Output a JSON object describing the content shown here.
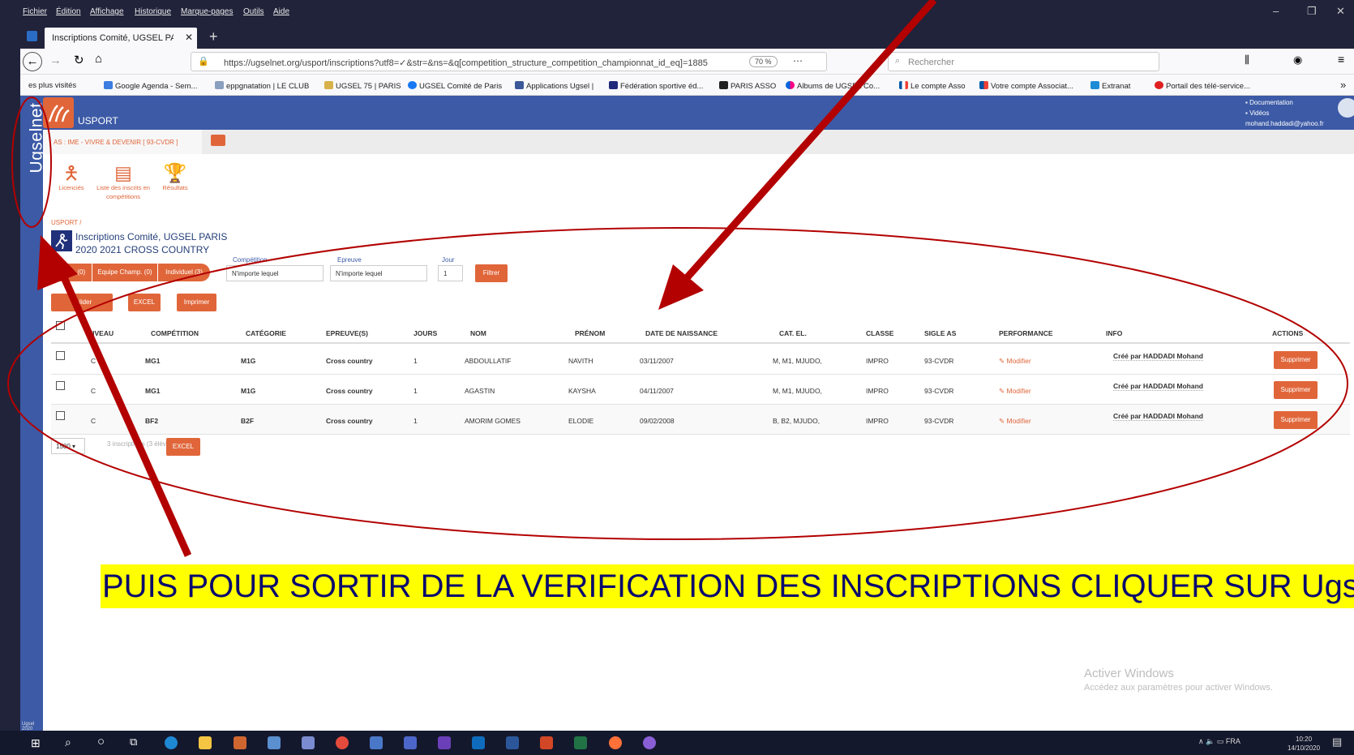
{
  "browser": {
    "menus": [
      "Fichier",
      "Édition",
      "Affichage",
      "Historique",
      "Marque-pages",
      "Outils",
      "Aide"
    ],
    "tab_title": "Inscriptions Comité, UGSEL PARIS",
    "url": "https://ugselnet.org/usport/inscriptions?utf8=✓&str=&ns=&q[competition_structure_competition_championnat_id_eq]=1885",
    "zoom": "70 %",
    "search_placeholder": "Rechercher",
    "bookmarks": [
      "es plus visités",
      "Google Agenda - Sem...",
      "eppgnatation | LE CLUB",
      "UGSEL 75 | PARIS",
      "UGSEL Comité de Paris",
      "Applications Ugsel |",
      "Fédération sportive éd...",
      "PARIS ASSO",
      "Albums de UGSEL Co...",
      "Le compte Asso",
      "Votre compte Associat...",
      "Extranat",
      "Portail des télé-service..."
    ]
  },
  "sidebar": {
    "label": "Ugselnet",
    "footer": "Ugsel 2020"
  },
  "header": {
    "brand": "USPORT",
    "links": [
      "Documentation",
      "Vidéos"
    ],
    "email": "mohand.haddadi@yahoo.fr"
  },
  "club_tab": "AS : IME - VIVRE & DEVENIR [ 93-CVDR ]",
  "app_icons": [
    {
      "label": "Licenciés",
      "icon": "person-icon"
    },
    {
      "label": "Liste des inscrits en compétitions",
      "icon": "list-icon"
    },
    {
      "label": "Résultats",
      "icon": "trophy-icon"
    }
  ],
  "breadcrumb": "USPORT /",
  "page_title": "Inscriptions Comité, UGSEL PARIS",
  "page_subtitle": "2020 2021 CROSS COUNTRY",
  "filters": {
    "segments": [
      "Relais (0)",
      "Equipe Champ. (0)",
      "Individuel (3)"
    ],
    "competition_label": "Compétition",
    "competition_value": "N'importe lequel",
    "epreuve_label": "Epreuve",
    "epreuve_value": "N'importe lequel",
    "jour_label": "Jour",
    "jour_value": "1",
    "filter_button": "Filtrer"
  },
  "actions": {
    "valider": "Valider",
    "excel": "EXCEL",
    "print": "Imprimer"
  },
  "table": {
    "headers": [
      "NIVEAU",
      "COMPÉTITION",
      "CATÉGORIE",
      "EPREUVE(S)",
      "JOURS",
      "NOM",
      "PRÉNOM",
      "DATE DE NAISSANCE",
      "CAT. EL.",
      "CLASSE",
      "SIGLE AS",
      "PERFORMANCE",
      "INFO",
      "ACTIONS"
    ],
    "rows": [
      {
        "niveau": "C",
        "competition": "MG1",
        "categorie": "M1G",
        "epreuve": "Cross country",
        "jours": "1",
        "nom": "ABDOULLATIF",
        "prenom": "NAVITH",
        "naissance": "03/11/2007",
        "cat_el": "M, M1, MJUDO,",
        "classe": "IMPRO",
        "sigle": "93-CVDR",
        "performance": "Modifier",
        "info": "Créé par HADDADI Mohand",
        "action": "Supprimer"
      },
      {
        "niveau": "C",
        "competition": "MG1",
        "categorie": "M1G",
        "epreuve": "Cross country",
        "jours": "1",
        "nom": "AGASTIN",
        "prenom": "KAYSHA",
        "naissance": "04/11/2007",
        "cat_el": "M, M1, MJUDO,",
        "classe": "IMPRO",
        "sigle": "93-CVDR",
        "performance": "Modifier",
        "info": "Créé par HADDADI Mohand",
        "action": "Supprimer"
      },
      {
        "niveau": "C",
        "competition": "BF2",
        "categorie": "B2F",
        "epreuve": "Cross country",
        "jours": "1",
        "nom": "AMORIM GOMES",
        "prenom": "ELODIE",
        "naissance": "09/02/2008",
        "cat_el": "B, B2, MJUDO,",
        "classe": "IMPRO",
        "sigle": "93-CVDR",
        "performance": "Modifier",
        "info": "Créé par HADDADI Mohand",
        "action": "Supprimer"
      }
    ]
  },
  "footer": {
    "page_size": "1500",
    "count": "3 inscriptions (3 élèves)",
    "excel": "EXCEL"
  },
  "banner": "PUIS POUR SORTIR DE LA VERIFICATION DES INSCRIPTIONS CLIQUER SUR Ugseln",
  "watermark": {
    "title": "Activer Windows",
    "subtitle": "Accédez aux paramètres pour activer Windows."
  },
  "taskbar": {
    "time": "10:20",
    "date": "14/10/2020",
    "lang": "FRA"
  },
  "colors": {
    "accent": "#e0663a",
    "sidebar": "#3c5aa6",
    "annotation": "#b30000",
    "highlight": "#ffff00"
  }
}
